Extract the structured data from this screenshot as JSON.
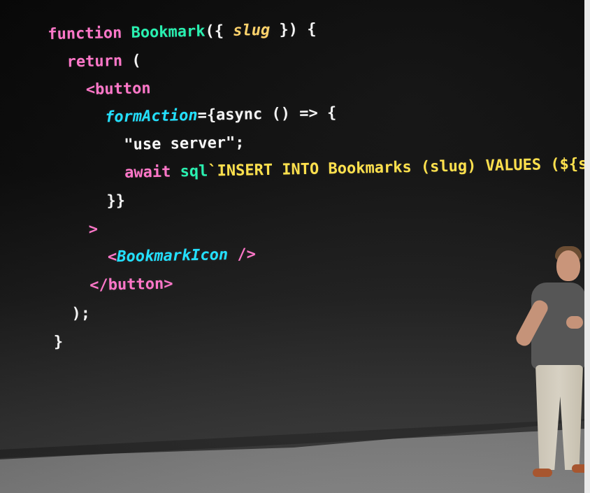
{
  "code_slide": {
    "line1": {
      "kw": "function",
      "fn": "Bookmark",
      "open": "({ ",
      "param": "slug",
      "close": " }) {"
    },
    "line2": {
      "kw": "return",
      "rest": " ("
    },
    "line3": {
      "tag": "<button"
    },
    "line4": {
      "attr": "formAction",
      "rest": "={async () => {"
    },
    "line5": {
      "str": "\"use server\";"
    },
    "line6": {
      "kw": "await",
      "fn": " sql",
      "tpl": "`INSERT INTO Bookmarks (slug) VALUES (${slug});`",
      "end": ";"
    },
    "line7": {
      "text": "}}"
    },
    "line8": {
      "text": ">"
    },
    "line9": {
      "open": "<",
      "tag": "BookmarkIcon",
      "close": " />"
    },
    "line10": {
      "tag": "</button>"
    },
    "line11": {
      "text": ");"
    },
    "line12": {
      "text": "}"
    }
  }
}
